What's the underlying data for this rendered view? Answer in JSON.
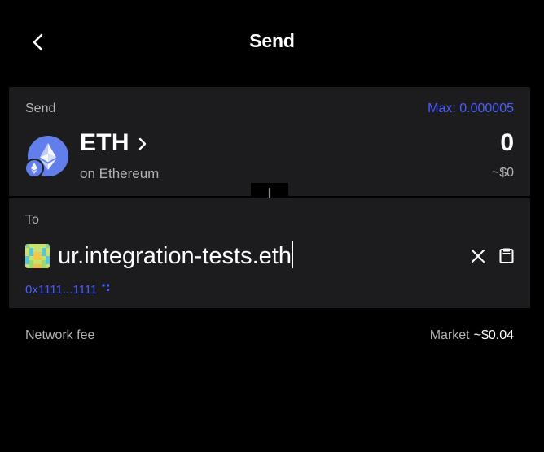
{
  "header": {
    "title": "Send"
  },
  "send": {
    "label": "Send",
    "max_label": "Max: 0.000005",
    "token_symbol": "ETH",
    "token_network": "on Ethereum",
    "amount": "0",
    "amount_usd": "~$0"
  },
  "to": {
    "label": "To",
    "address_input": "ur.integration-tests.eth",
    "resolved_address": "0x1111...1111"
  },
  "network_fee": {
    "label": "Network fee",
    "speed": "Market",
    "value": "~$0.04"
  },
  "colors": {
    "accent": "#4b5cff",
    "eth": "#627eea",
    "card": "#1c1c1f",
    "background": "#000000"
  },
  "icons": [
    "back-arrow-icon",
    "eth-token-icon",
    "ethereum-chain-badge-icon",
    "chevron-right-icon",
    "arrow-down-icon",
    "close-icon",
    "paste-icon",
    "copy-icon",
    "identicon-avatar"
  ]
}
